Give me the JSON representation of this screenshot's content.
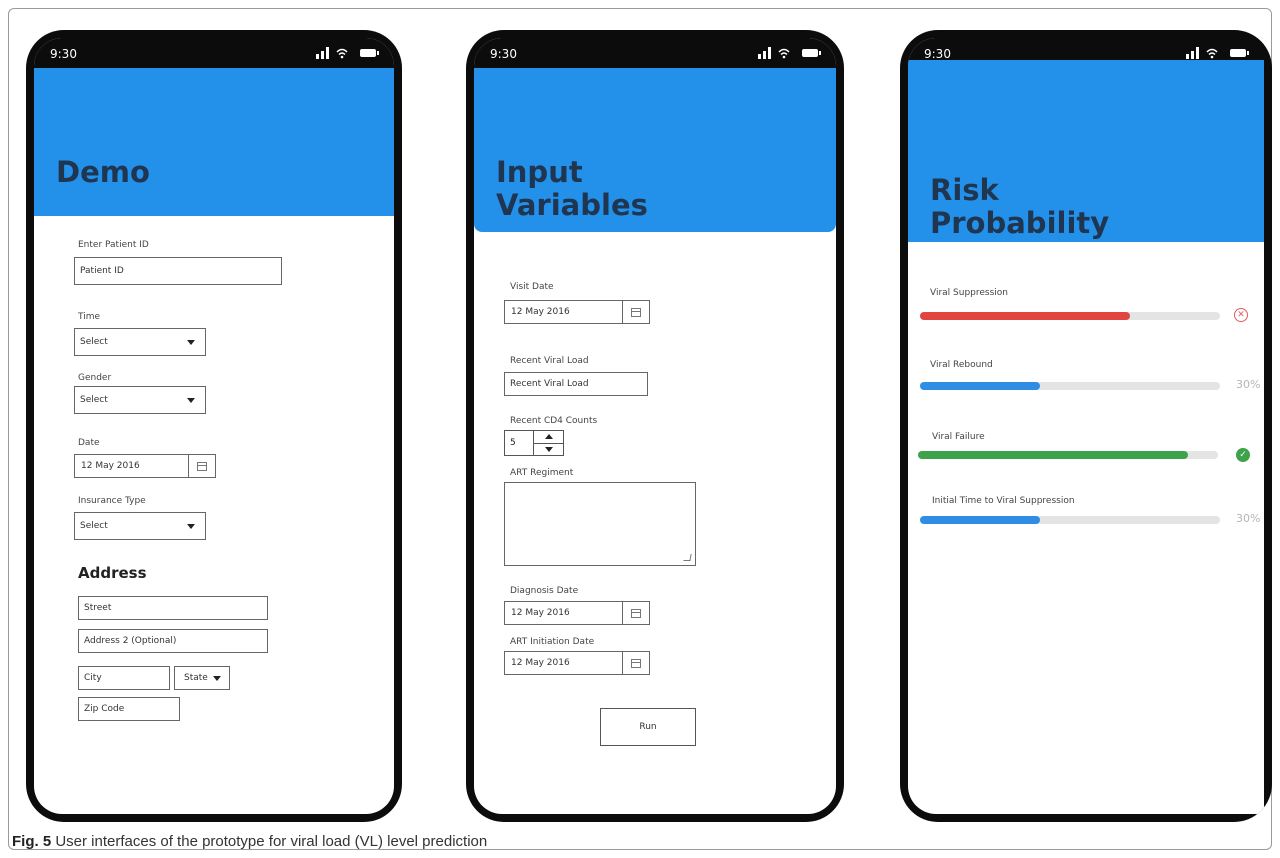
{
  "status_time": "9:30",
  "screens": {
    "demo": {
      "title": "Demo",
      "patient_id_label": "Enter Patient ID",
      "patient_id_placeholder": "Patient ID",
      "time_label": "Time",
      "time_value": "Select",
      "gender_label": "Gender",
      "gender_value": "Select",
      "date_label": "Date",
      "date_value": "12 May 2016",
      "insurance_label": "Insurance Type",
      "insurance_value": "Select",
      "address_title": "Address",
      "street_placeholder": "Street",
      "address2_placeholder": "Address 2 (Optional)",
      "city_placeholder": "City",
      "state_value": "State",
      "zip_placeholder": "Zip Code"
    },
    "input": {
      "title_line1": "Input",
      "title_line2": "Variables",
      "visit_date_label": "Visit Date",
      "visit_date_value": "12 May 2016",
      "recent_vl_label": "Recent Viral Load",
      "recent_vl_placeholder": "Recent Viral Load",
      "cd4_label": "Recent CD4 Counts",
      "cd4_value": "5",
      "art_regiment_label": "ART Regiment",
      "diagnosis_date_label": "Diagnosis Date",
      "diagnosis_date_value": "12 May 2016",
      "art_initiation_label": "ART Initiation Date",
      "art_initiation_value": "12 May 2016",
      "run_label": "Run"
    },
    "risk": {
      "title_line1": "Risk",
      "title_line2": "Probability",
      "items": [
        {
          "label": "Viral Suppression",
          "fill": 0.7,
          "color": "#e0453f",
          "status": "✕",
          "status_kind": "error"
        },
        {
          "label": "Viral Rebound",
          "fill": 0.4,
          "color": "#2f8de4",
          "status": "30%",
          "status_kind": "percent"
        },
        {
          "label": "Viral Failure",
          "fill": 0.9,
          "color": "#3ea24a",
          "status": "✓",
          "status_kind": "ok"
        },
        {
          "label": "Initial Time to Viral Suppression",
          "fill": 0.4,
          "color": "#2f8de4",
          "status": "30%",
          "status_kind": "percent"
        }
      ]
    }
  },
  "caption": {
    "fig": "Fig. 5",
    "text": "User interfaces of the prototype for viral load (VL) level prediction"
  }
}
